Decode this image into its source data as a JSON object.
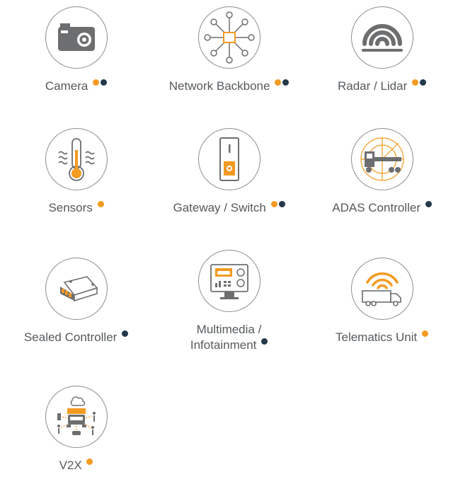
{
  "colors": {
    "accent_orange": "#f39a21",
    "accent_navy": "#23384a",
    "icon_gray": "#6d6e70",
    "circle_border": "#8e8e8e",
    "text": "#555a5e"
  },
  "items": [
    {
      "icon": "camera-icon",
      "label": "Camera",
      "dots": [
        "orange",
        "navy"
      ]
    },
    {
      "icon": "network-backbone-icon",
      "label": "Network Backbone",
      "dots": [
        "orange",
        "navy"
      ]
    },
    {
      "icon": "radar-lidar-icon",
      "label": "Radar / Lidar",
      "dots": [
        "orange",
        "navy"
      ]
    },
    {
      "icon": "thermometer-sensor-icon",
      "label": "Sensors",
      "dots": [
        "orange"
      ]
    },
    {
      "icon": "gateway-switch-icon",
      "label": "Gateway / Switch",
      "dots": [
        "orange",
        "navy"
      ]
    },
    {
      "icon": "adas-truck-radar-icon",
      "label": "ADAS Controller",
      "dots": [
        "navy"
      ]
    },
    {
      "icon": "sealed-controller-module-icon",
      "label": "Sealed Controller",
      "dots": [
        "navy"
      ]
    },
    {
      "icon": "multimedia-monitor-icon",
      "label_line1": "Multimedia /",
      "label_line2": "Infotainment",
      "dots": [
        "navy"
      ]
    },
    {
      "icon": "telematics-truck-signal-icon",
      "label": "Telematics Unit",
      "dots": [
        "orange"
      ]
    },
    {
      "icon": "v2x-connected-truck-icon",
      "label": "V2X",
      "dots": [
        "orange"
      ]
    }
  ]
}
